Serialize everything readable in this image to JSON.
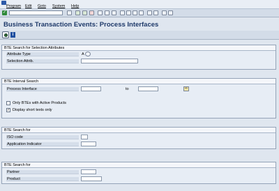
{
  "menu": {
    "items": [
      "Program",
      "Edit",
      "Goto",
      "System",
      "Help"
    ]
  },
  "window": {
    "title": "Business Transaction Events: Process Interfaces"
  },
  "groups": {
    "selection": {
      "title": "BTE Search for Selection Attributes",
      "attribute_type_label": "Attribute Type",
      "attribute_type_value": "A",
      "selection_attrib_label": "Selection Attrib.",
      "selection_attrib_value": ""
    },
    "interval": {
      "title": "BTE Interval Search",
      "process_interface_label": "Process Interface",
      "process_interface_from": "",
      "to_label": "to",
      "process_interface_to": "",
      "only_active_label": "Only BTEs with Active Products",
      "only_active_checked": false,
      "short_texts_label": "Display short texts only",
      "short_texts_checked": true
    },
    "iso": {
      "title": "BTE Search for",
      "iso_code_label": "ISO code",
      "iso_code_value": "",
      "app_indicator_label": "Application Indicator",
      "app_indicator_value": ""
    },
    "partner": {
      "title": "BTE Search for",
      "partner_label": "Partner",
      "partner_value": "",
      "product_label": "Product",
      "product_value": ""
    }
  },
  "glyphs": {
    "check": "✓",
    "checked": "✓",
    "info": "i",
    "multi_select": "⇨"
  }
}
